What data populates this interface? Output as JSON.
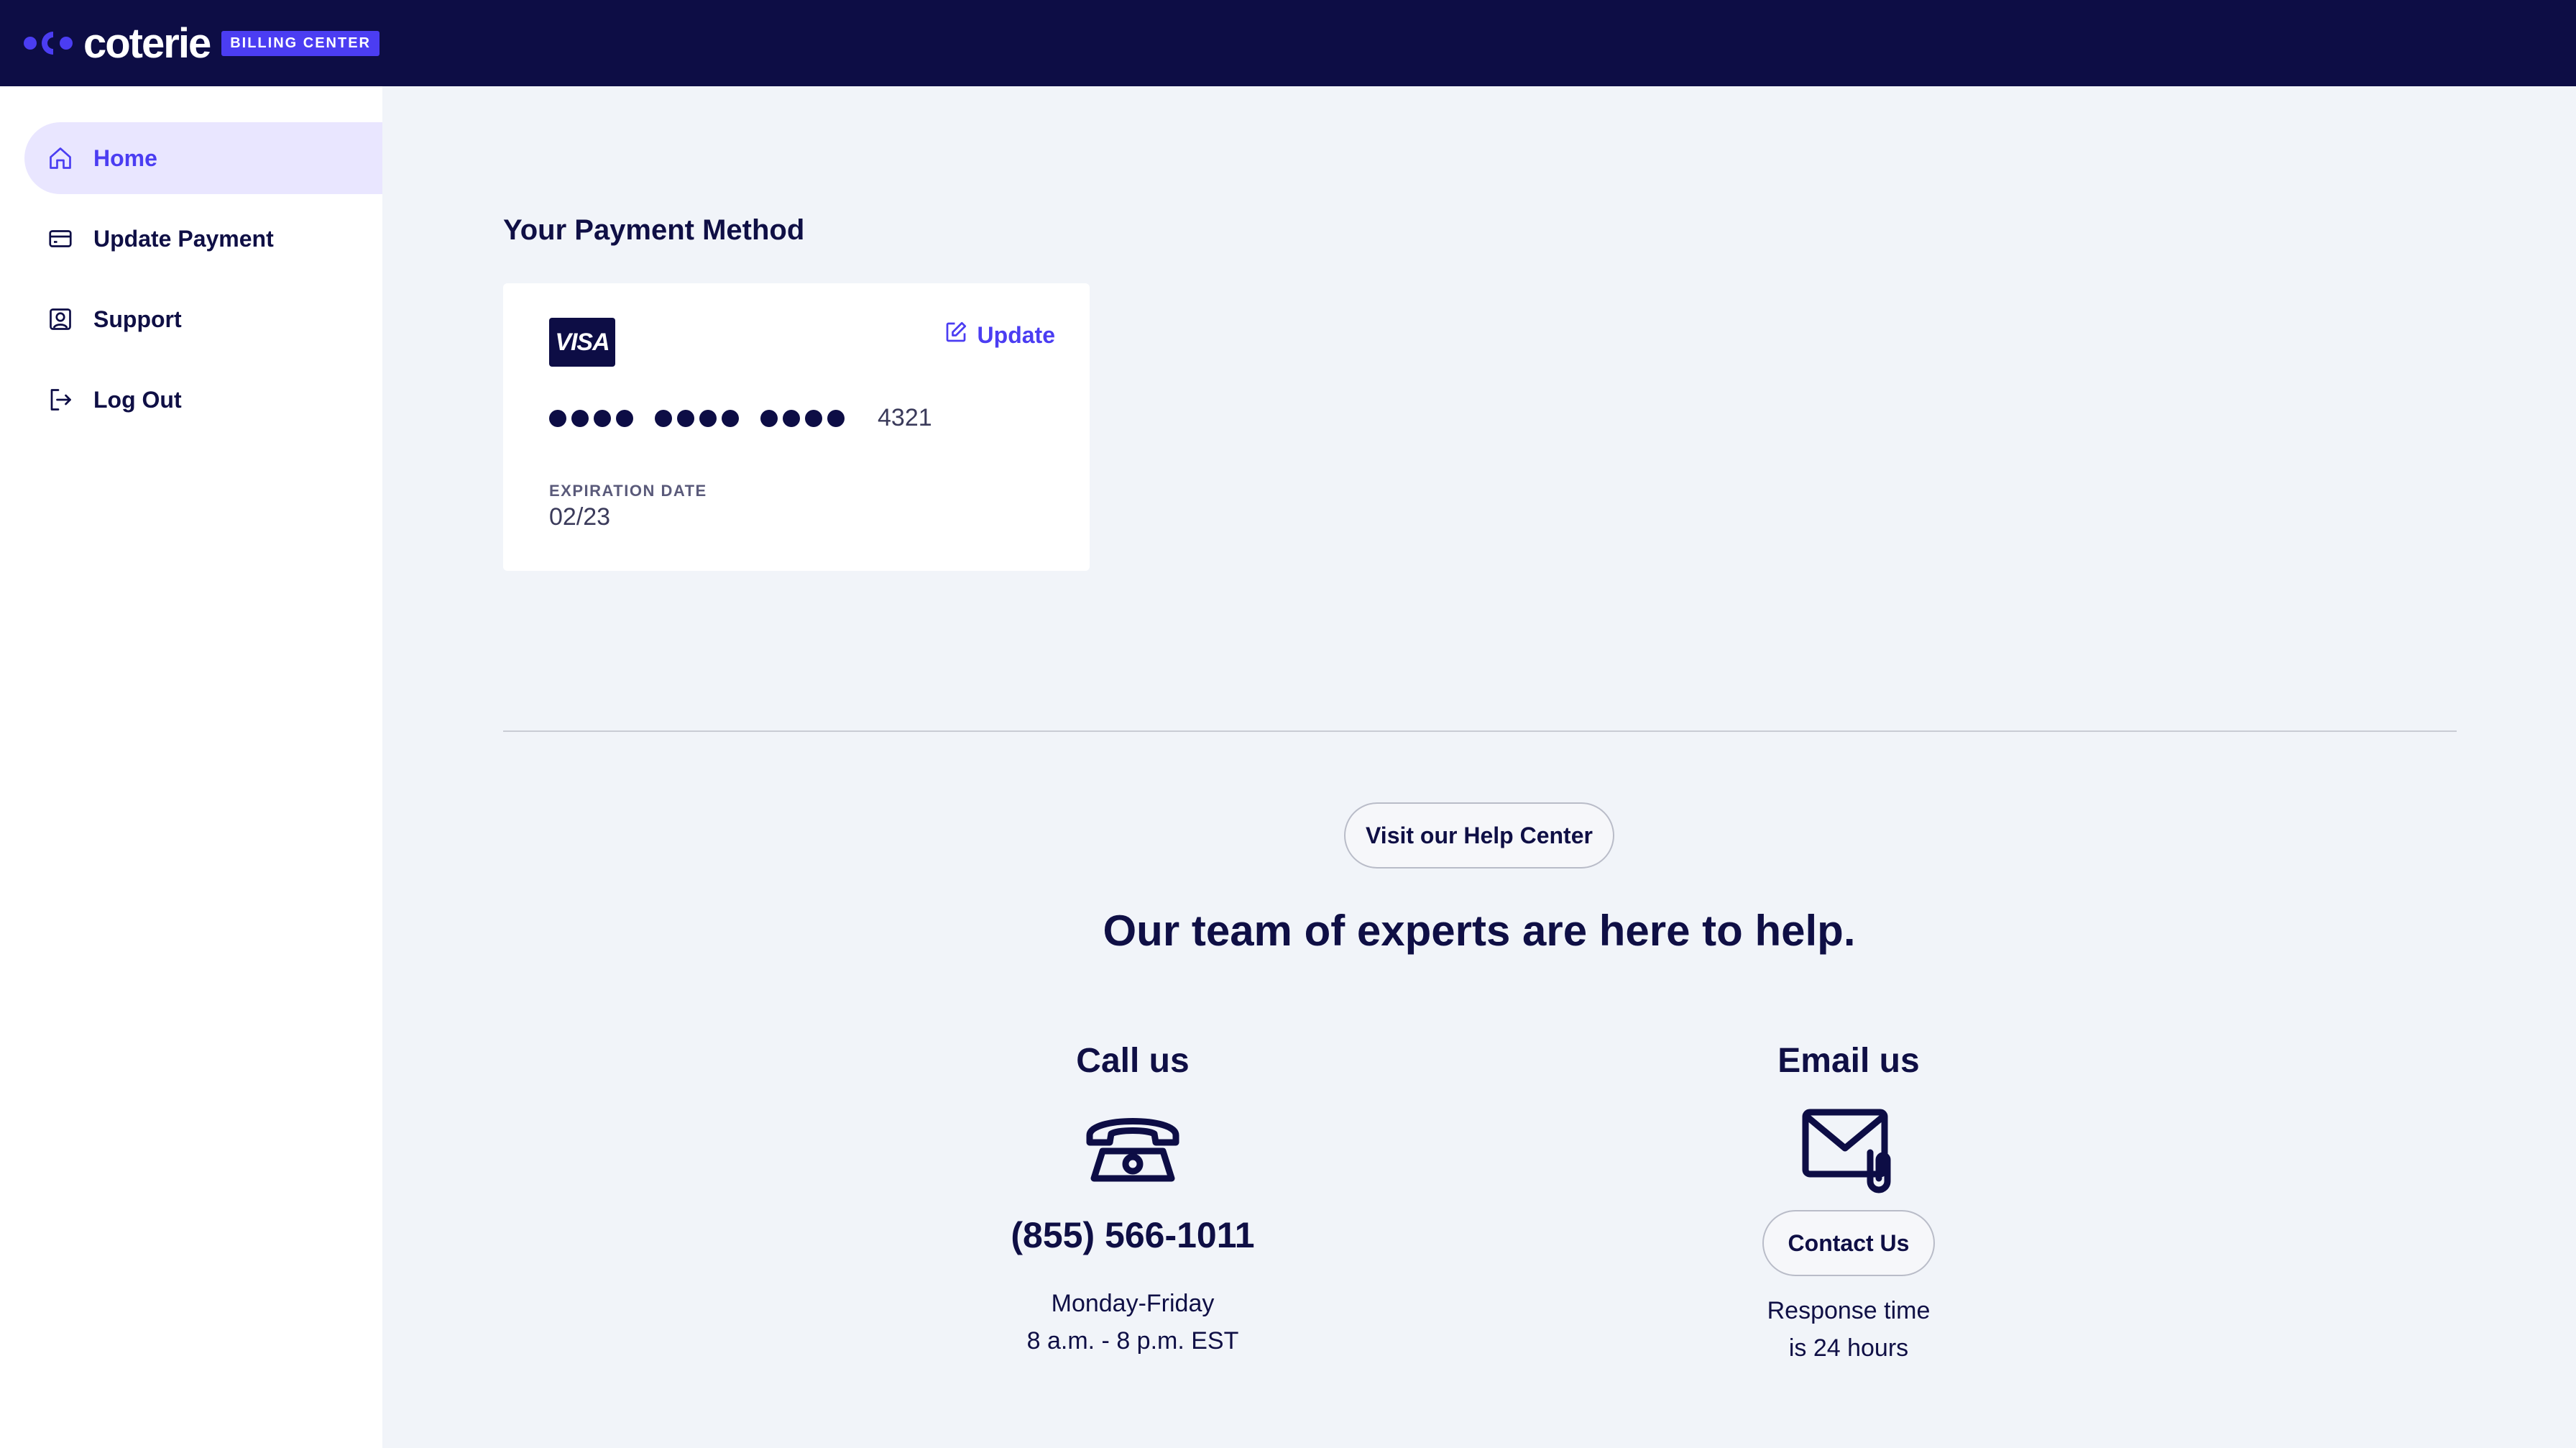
{
  "brand": {
    "name": "coterie",
    "badge": "BILLING CENTER",
    "colors": {
      "navy": "#0d0d45",
      "accent": "#4b3df2",
      "active_bg": "#e9e6ff",
      "page_bg": "#f1f4f9"
    }
  },
  "sidebar": {
    "items": [
      {
        "label": "Home",
        "icon": "home-icon",
        "active": true
      },
      {
        "label": "Update Payment",
        "icon": "credit-card-icon",
        "active": false
      },
      {
        "label": "Support",
        "icon": "user-badge-icon",
        "active": false
      },
      {
        "label": "Log Out",
        "icon": "logout-icon",
        "active": false
      }
    ]
  },
  "payment": {
    "section_title": "Your Payment Method",
    "card_brand": "VISA",
    "update_label": "Update",
    "last4": "4321",
    "expiration_label": "EXPIRATION DATE",
    "expiration_value": "02/23"
  },
  "help": {
    "help_center_button": "Visit our Help Center",
    "heading": "Our team of experts are here to help.",
    "call": {
      "title": "Call us",
      "icon": "phone-icon",
      "number": "(855) 566-1011",
      "days": "Monday-Friday",
      "hours": "8 a.m. - 8 p.m. EST"
    },
    "email": {
      "title": "Email us",
      "icon": "mail-attachment-icon",
      "button": "Contact Us",
      "response_line1": "Response time",
      "response_line2": "is 24 hours"
    }
  }
}
